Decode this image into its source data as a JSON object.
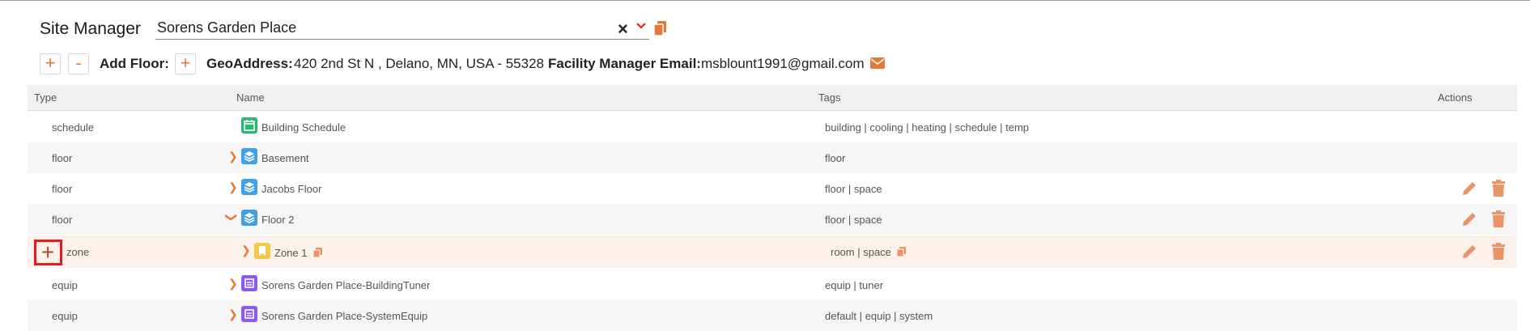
{
  "header": {
    "site_label": "Site Manager",
    "site_value": "Sorens Garden Place"
  },
  "toolbar": {
    "add_symbol": "+",
    "remove_symbol": "-",
    "add_floor_label": "Add Floor:",
    "geo_label": "GeoAddress:",
    "geo_value": "420 2nd St N , Delano, MN, USA - 55328",
    "fm_label": "Facility Manager Email:",
    "fm_value": "msblount1991@gmail.com"
  },
  "table": {
    "columns": [
      "Type",
      "Name",
      "Tags",
      "Actions"
    ],
    "rows": [
      {
        "type": "schedule",
        "name": "Building Schedule",
        "tags": "building | cooling | heating | schedule | temp"
      },
      {
        "type": "floor",
        "name": "Basement",
        "tags": "floor"
      },
      {
        "type": "floor",
        "name": "Jacobs Floor",
        "tags": "floor | space"
      },
      {
        "type": "floor",
        "name": "Floor 2",
        "tags": "floor | space"
      },
      {
        "type": "zone",
        "name": "Zone 1",
        "tags": "room | space"
      },
      {
        "type": "equip",
        "name": "Sorens Garden Place-BuildingTuner",
        "tags": "equip | tuner"
      },
      {
        "type": "equip",
        "name": "Sorens Garden Place-SystemEquip",
        "tags": "default | equip | system"
      }
    ]
  },
  "colors": {
    "accent": "#e07b3a",
    "schedule_icon": "#2bb673",
    "floor_icon": "#3f9fe8",
    "zone_icon": "#f5c84c",
    "equip_icon": "#8a5cf0",
    "highlight_border": "#e41c1c"
  },
  "icons": {
    "clear": "close-icon",
    "dropdown": "chevron-down-icon",
    "copy": "copy-icon",
    "mail": "envelope-icon",
    "edit": "pencil-icon",
    "delete": "trash-icon"
  }
}
